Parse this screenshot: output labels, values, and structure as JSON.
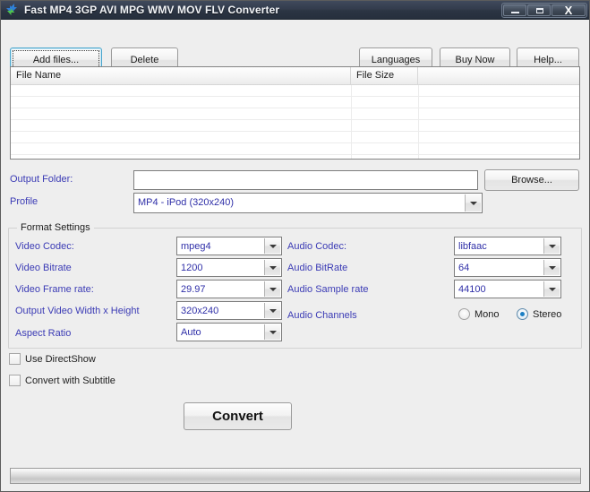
{
  "window": {
    "title": "Fast MP4 3GP AVI MPG WMV MOV FLV Converter",
    "app_icon": "converter-arrows-icon",
    "controls": {
      "minimize": "minimize-icon",
      "maximize": "maximize-icon",
      "close": "X"
    }
  },
  "toolbar": {
    "add_files_label": "Add files...",
    "delete_label": "Delete",
    "languages_label": "Languages",
    "buy_now_label": "Buy Now",
    "help_label": "Help..."
  },
  "file_list": {
    "columns": [
      "File Name",
      "File Size",
      ""
    ],
    "rows": []
  },
  "output": {
    "folder_label": "Output Folder:",
    "folder_value": "",
    "folder_placeholder": "",
    "browse_label": "Browse...",
    "profile_label": "Profile",
    "profile_value": "MP4 - iPod (320x240)"
  },
  "format_settings": {
    "legend": "Format Settings",
    "video": [
      {
        "label": "Video Codec:",
        "value": "mpeg4"
      },
      {
        "label": "Video Bitrate",
        "value": "1200"
      },
      {
        "label": "Video Frame rate:",
        "value": "29.97"
      },
      {
        "label": "Output Video Width x Height",
        "value": "320x240"
      },
      {
        "label": "Aspect Ratio",
        "value": "Auto"
      }
    ],
    "audio": [
      {
        "label": "Audio Codec:",
        "value": "libfaac"
      },
      {
        "label": "Audio BitRate",
        "value": "64"
      },
      {
        "label": "Audio Sample rate",
        "value": "44100"
      }
    ],
    "channels": {
      "label": "Audio Channels",
      "mono_label": "Mono",
      "stereo_label": "Stereo",
      "selected": "Stereo"
    }
  },
  "options": {
    "use_directshow_label": "Use DirectShow",
    "use_directshow_checked": false,
    "convert_with_subtitle_label": "Convert with Subtitle",
    "convert_with_subtitle_checked": false
  },
  "action": {
    "convert_label": "Convert"
  },
  "progress": {
    "value": 0
  },
  "colors": {
    "titlebar": "#333c4d",
    "label_blue": "#3b3bb5",
    "value_blue": "#2f2fa8",
    "focus_border": "#4ba6cd",
    "radio_dot": "#1b7fc4",
    "window_bg": "#eeeeee"
  }
}
